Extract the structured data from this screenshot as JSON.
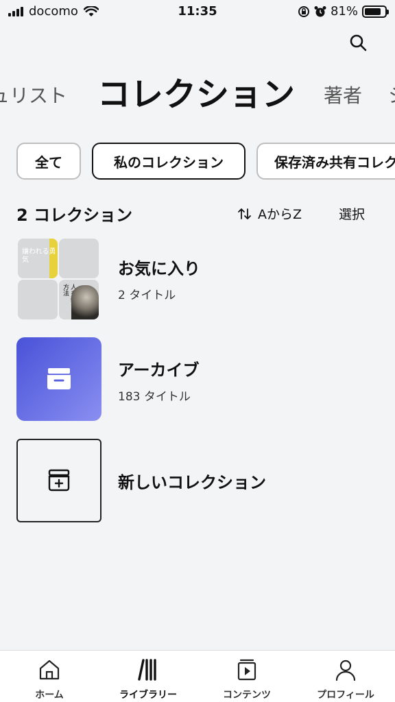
{
  "status_bar": {
    "carrier": "docomo",
    "time": "11:35",
    "battery_text": "81%",
    "battery_level": 0.81
  },
  "header": {
    "search_icon": "search-icon"
  },
  "top_tabs": [
    {
      "label": "ュリスト"
    },
    {
      "label": "コレクション",
      "active": true
    },
    {
      "label": "著者"
    },
    {
      "label": "シ"
    }
  ],
  "filters": [
    {
      "label": "全て"
    },
    {
      "label": "私のコレクション",
      "selected": true
    },
    {
      "label": "保存済み共有コレク"
    }
  ],
  "list_meta": {
    "count": "2 コレクション",
    "sort_label": "AからZ",
    "select_label": "選択"
  },
  "collections": [
    {
      "title": "お気に入り",
      "subtitle": "2 タイトル",
      "cover_a_text": "嫌われる勇気",
      "cover_b_text": "人を動かす方法"
    },
    {
      "title": "アーカイブ",
      "subtitle": "183 タイトル"
    }
  ],
  "new_collection": {
    "label": "新しいコレクション"
  },
  "bottom_nav": [
    {
      "label": "ホーム",
      "icon": "home-icon"
    },
    {
      "label": "ライブラリー",
      "icon": "library-icon",
      "active": true
    },
    {
      "label": "コンテンツ",
      "icon": "content-icon"
    },
    {
      "label": "プロフィール",
      "icon": "profile-icon"
    }
  ],
  "colors": {
    "background": "#f3f4f6",
    "archive_gradient_start": "#4a52d8",
    "archive_gradient_end": "#8a8ff0",
    "text": "#111111"
  }
}
